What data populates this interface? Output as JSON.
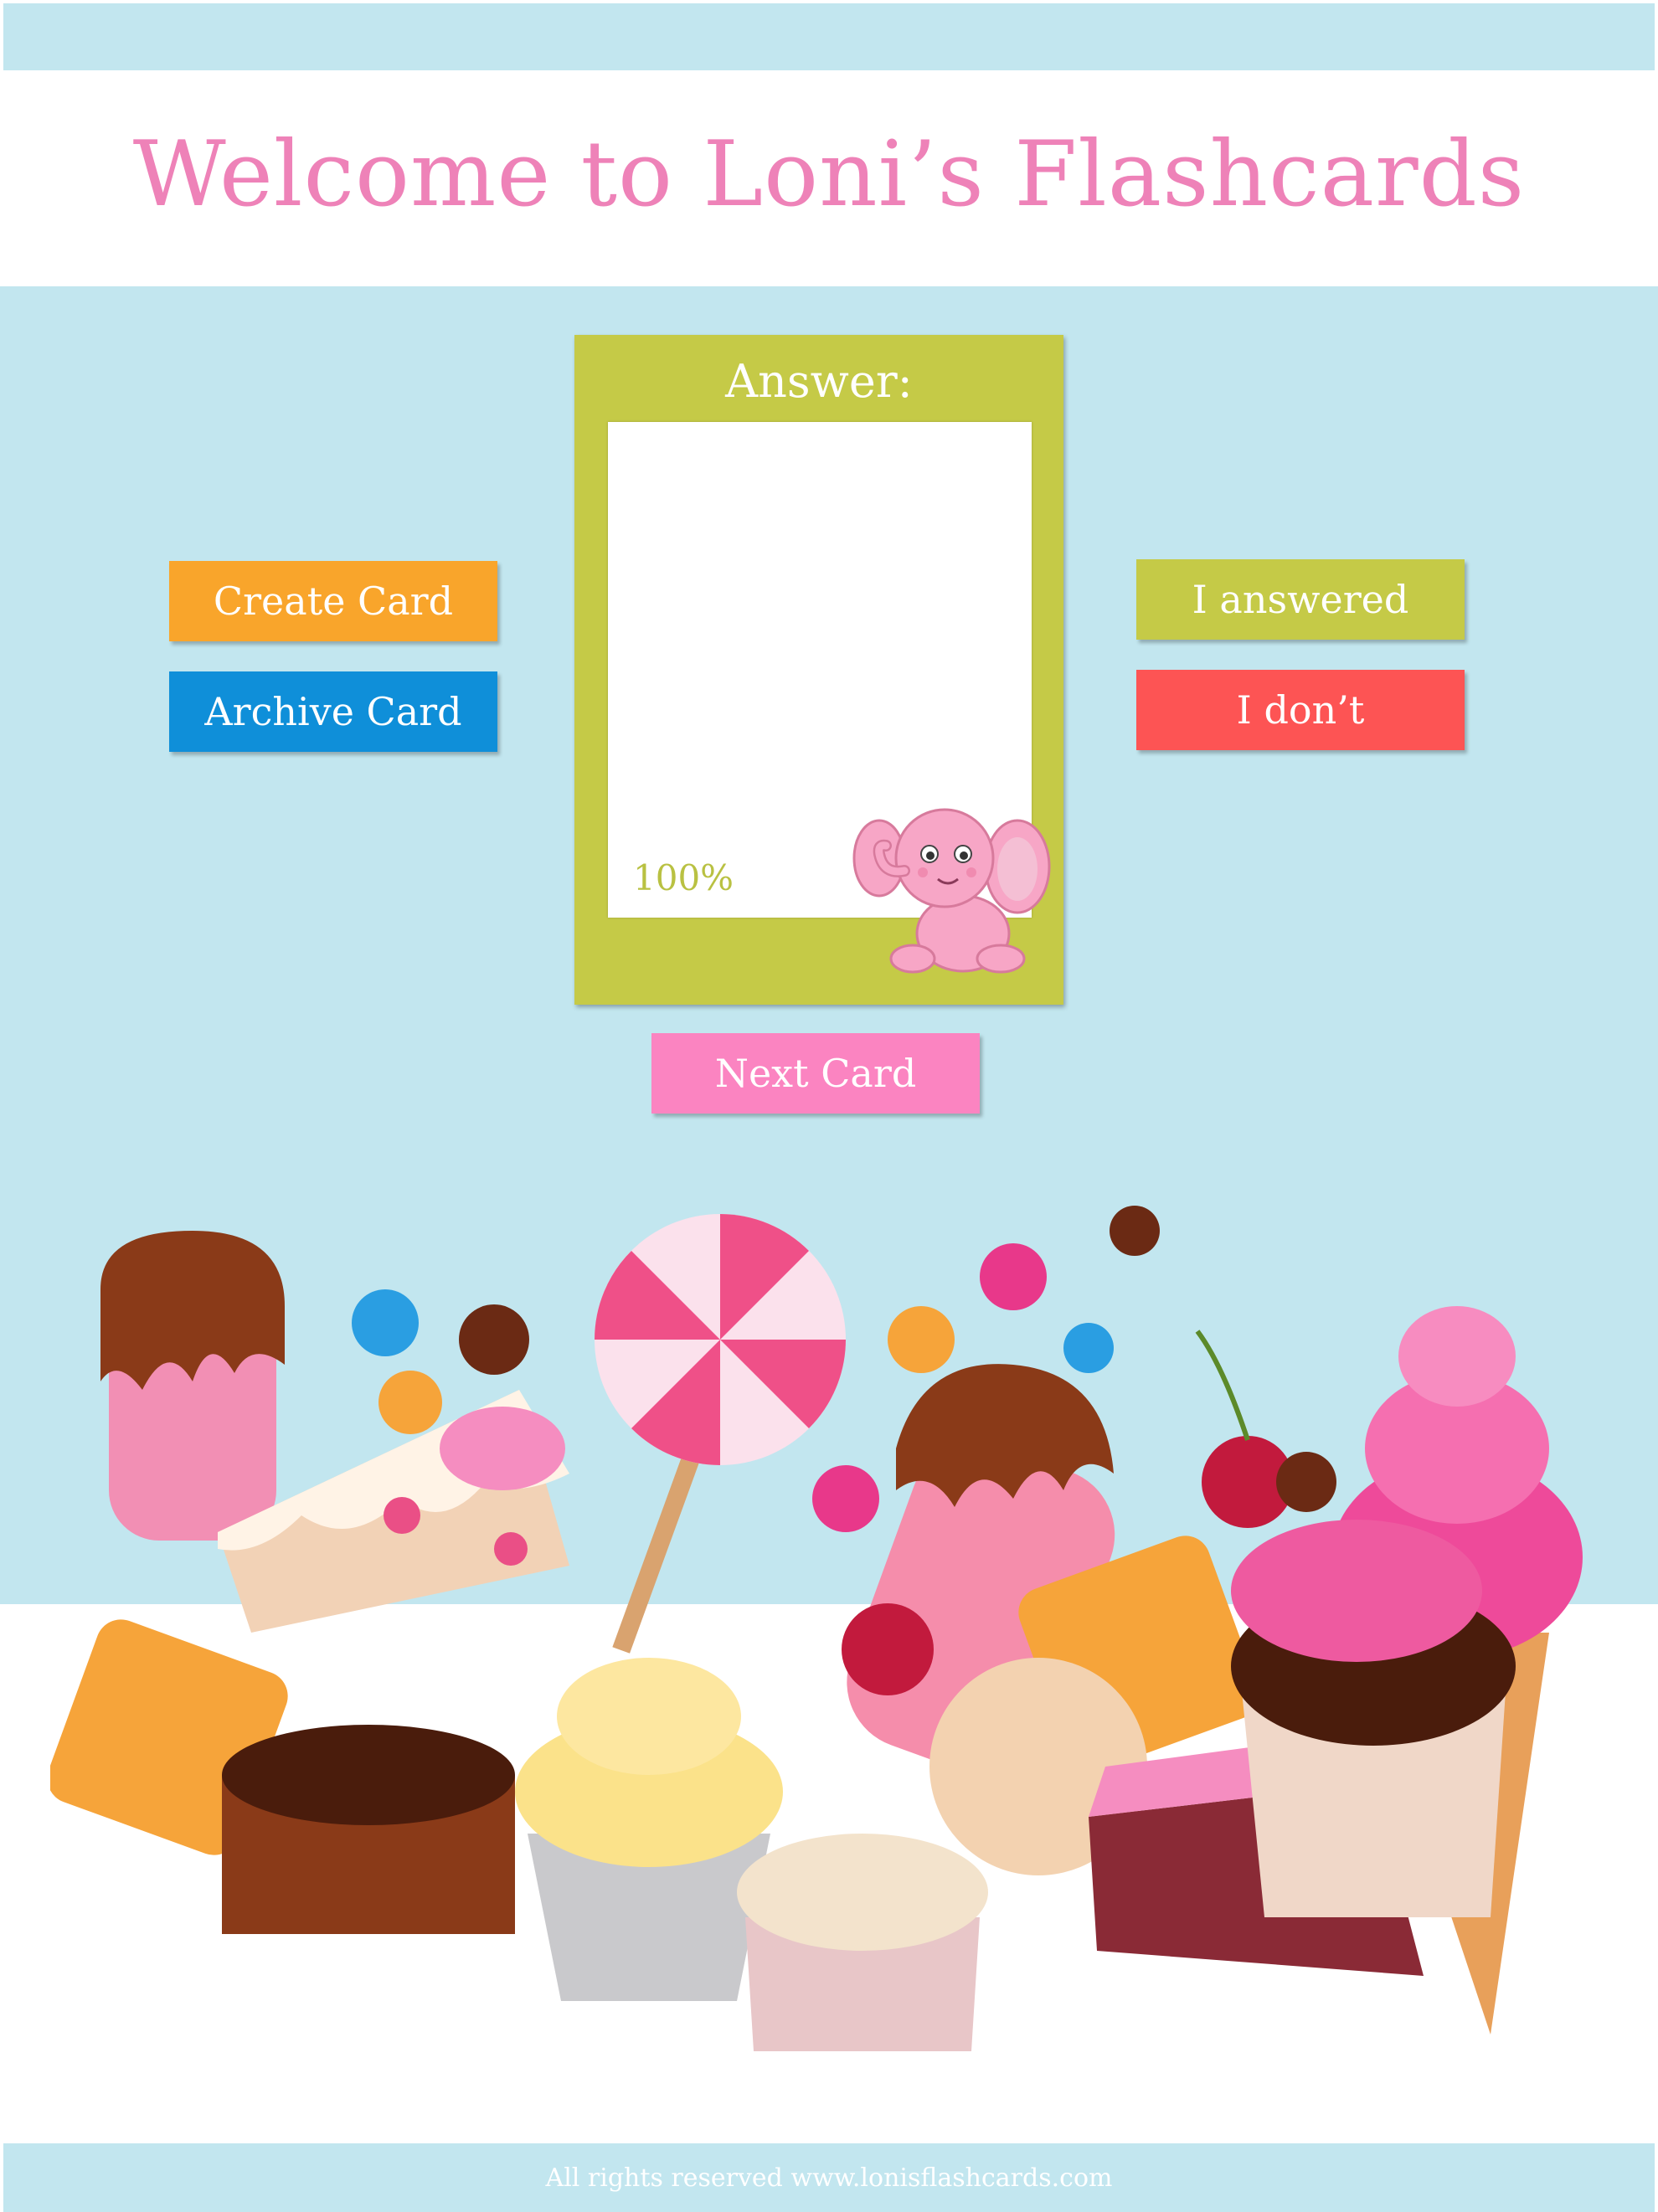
{
  "header": {
    "title": "Welcome to Loni’s Flashcards"
  },
  "card": {
    "label": "Answer:",
    "progress": "100%"
  },
  "actions": {
    "create_label": "Create Card",
    "archive_label": "Archive Card",
    "answered_label": "I answered",
    "dont_label": "I don’t",
    "next_label": "Next Card"
  },
  "footer": {
    "text": "All rights reserved www.lonisflashcards.com"
  },
  "colors": {
    "accent_pink": "#ee82b8",
    "create": "#f9a52b",
    "archive": "#0f8fd9",
    "answered": "#c5ca47",
    "dont": "#fd5454",
    "next": "#fb84c1",
    "background": "#c2e6ef"
  }
}
